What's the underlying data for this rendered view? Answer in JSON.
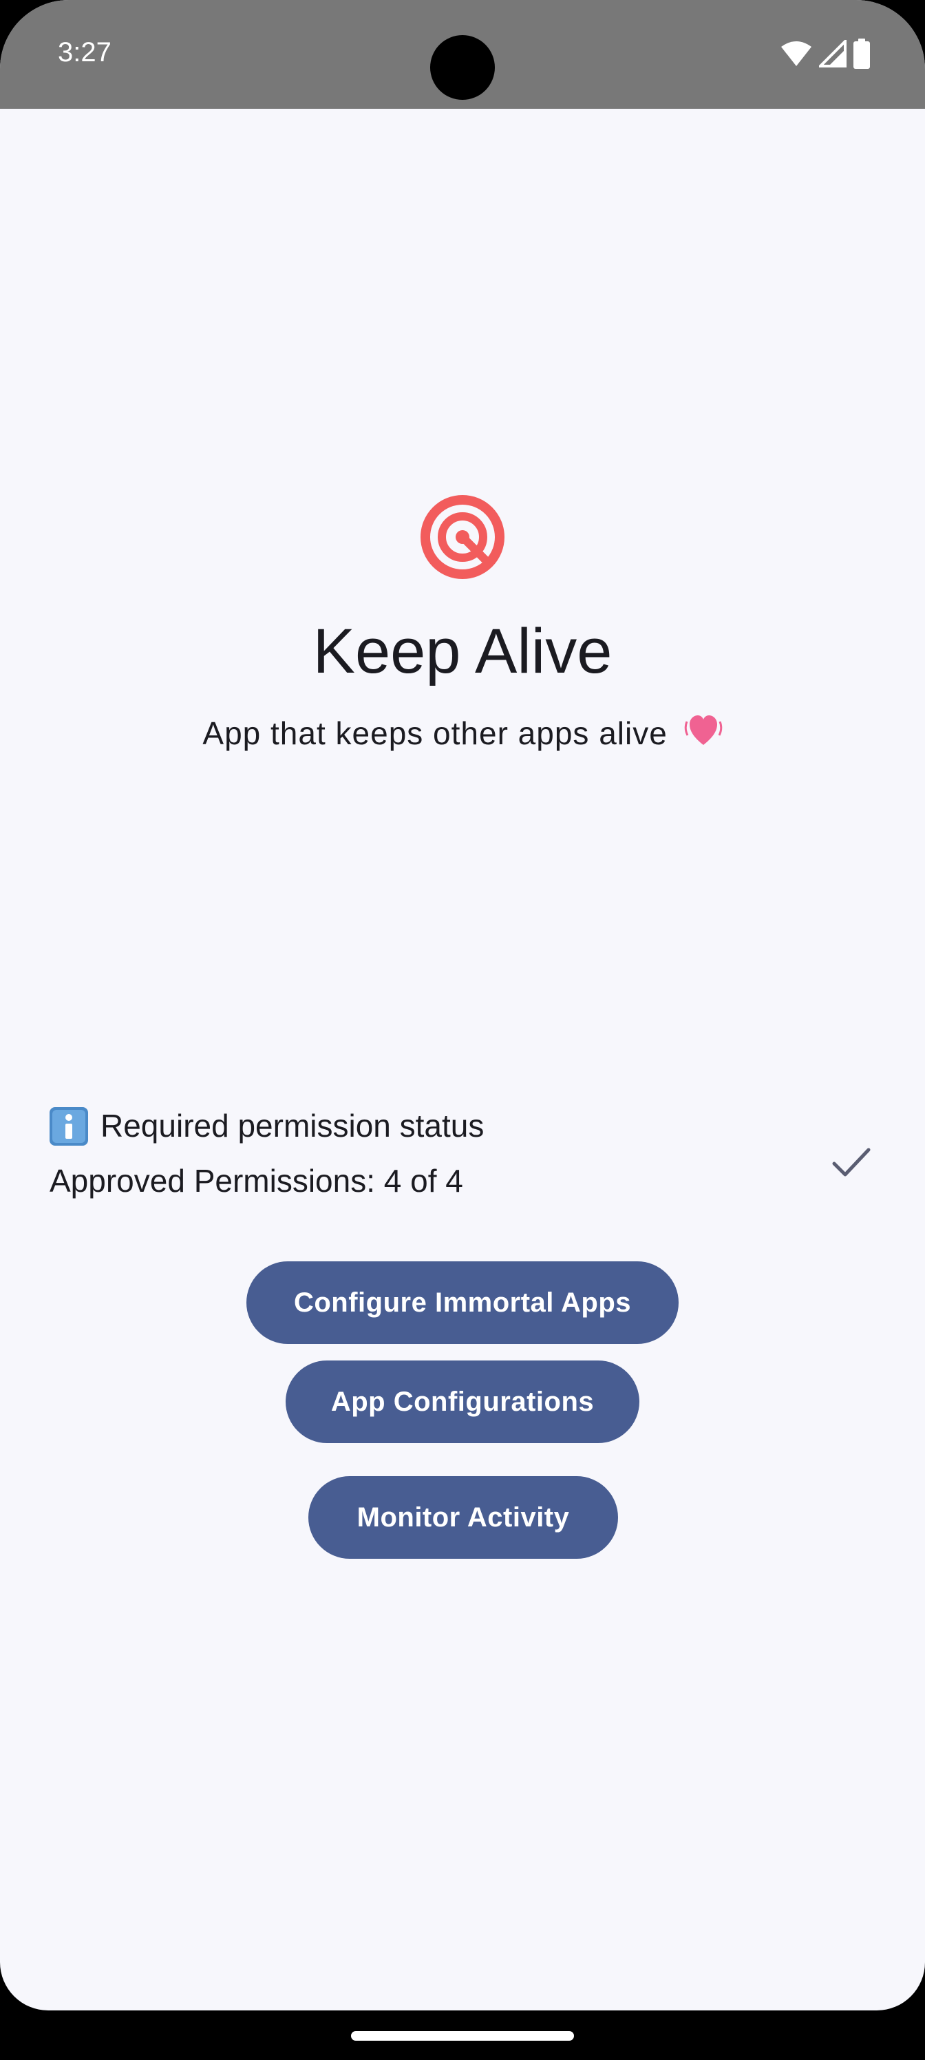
{
  "status_bar": {
    "time": "3:27",
    "icons": [
      "wifi-icon",
      "cellular-signal-icon",
      "battery-icon"
    ],
    "background_color": "#787878"
  },
  "hero": {
    "icon": "target-icon",
    "icon_color": "#f25c5c",
    "title": "Keep Alive",
    "subtitle": "App that keeps other apps alive",
    "subtitle_emoji": "vibrating-heart-icon"
  },
  "permissions": {
    "info_icon": "info-icon",
    "header": "Required permission status",
    "count_text": "Approved Permissions: 4 of 4",
    "approved": 4,
    "total": 4,
    "status_icon": "check-icon"
  },
  "buttons": {
    "configure_immortal_apps": "Configure Immortal Apps",
    "app_configurations": "App Configurations",
    "monitor_activity": "Monitor Activity",
    "color": "#485d92"
  },
  "colors": {
    "background": "#f7f7fc",
    "text": "#1b1b21"
  }
}
